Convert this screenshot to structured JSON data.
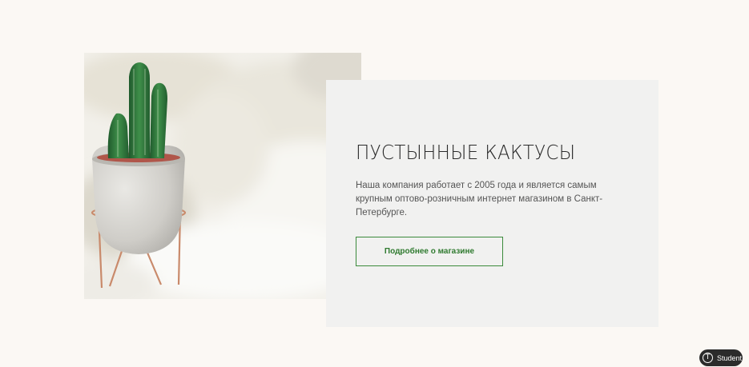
{
  "hero": {
    "image_subject": "cactus-in-concrete-pot-on-copper-stand"
  },
  "card": {
    "title": "ПУСТЫННЫЕ КАКТУСЫ",
    "description": "Наша компания работает с 2005 года и является самым крупным оптово-розничным интернет магазином в Санкт-Петербурге.",
    "button_label": "Подробнее о магазине"
  },
  "badge": {
    "icon": "T",
    "label": "Student"
  },
  "colors": {
    "page_background": "#fbf8f4",
    "card_background": "#f1f1f0",
    "accent_green": "#2f7a2f",
    "badge_background": "#2b2b2b"
  }
}
